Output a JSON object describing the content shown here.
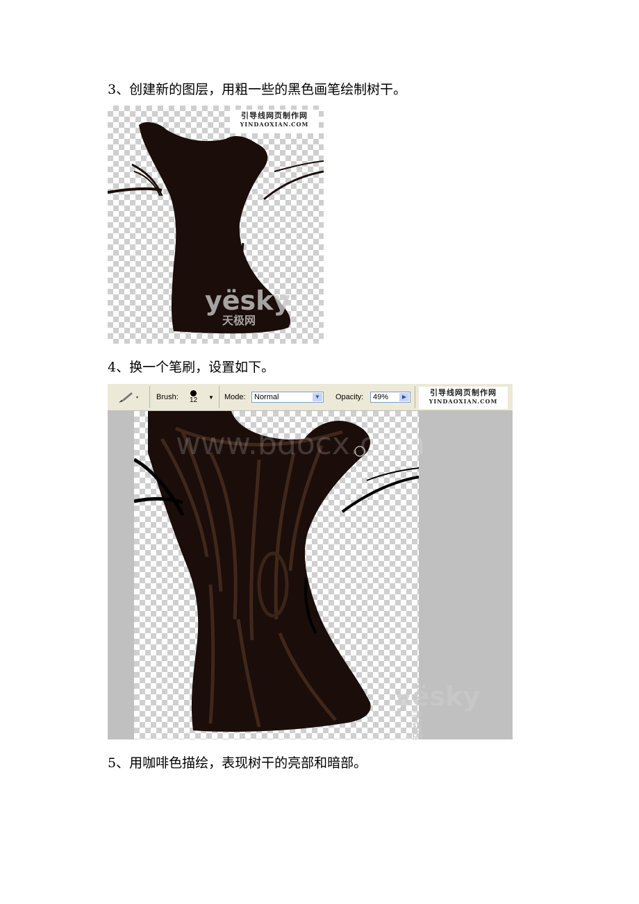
{
  "steps": [
    {
      "text": "3、创建新的图层，用粗一些的黑色画笔绘制树干。"
    },
    {
      "text": "4、换一个笔刷，设置如下。"
    },
    {
      "text": "5、用咖啡色描绘，表现树干的亮部和暗部。"
    }
  ],
  "watermark": {
    "cn": "引导线网页制作网",
    "en": "YINDAOXIAN.COM",
    "yesky": "yësky",
    "yesky_cn": "天极网",
    "yesky_com": ".com",
    "bdocx": "www.bdocx.com"
  },
  "toolbar": {
    "brush_label": "Brush:",
    "brush_size": "12",
    "mode_label": "Mode:",
    "mode_value": "Normal",
    "opacity_label": "Opacity:",
    "opacity_value": "49%"
  },
  "colors": {
    "trunk_black": "#1a0d0a",
    "trunk_brown": "#3a2418",
    "toolbar_bg": "#ece9d8",
    "canvas_gray": "#c0c0c0"
  }
}
